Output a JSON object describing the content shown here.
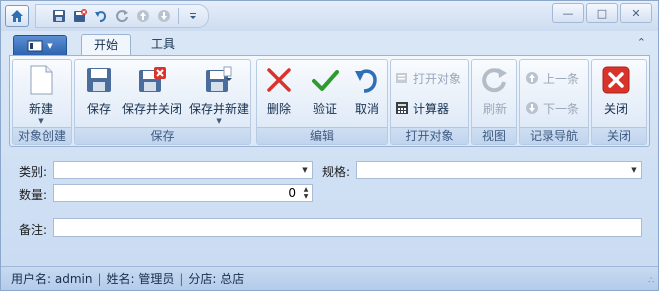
{
  "tabs": {
    "home": "开始",
    "tools": "工具"
  },
  "ribbon": {
    "groups": {
      "create": "对象创建",
      "save": "保存",
      "edit": "编辑",
      "open": "打开对象",
      "view": "视图",
      "nav": "记录导航",
      "close": "关闭"
    },
    "buttons": {
      "new": "新建",
      "save": "保存",
      "save_close": "保存并关闭",
      "save_new": "保存并新建",
      "delete": "删除",
      "validate": "验证",
      "cancel": "取消",
      "open_object": "打开对象",
      "calculator": "计算器",
      "refresh": "刷新",
      "prev": "上一条",
      "next": "下一条",
      "close": "关闭"
    }
  },
  "form": {
    "category_label": "类别:",
    "category_value": "",
    "spec_label": "规格:",
    "spec_value": "",
    "quantity_label": "数量:",
    "quantity_value": "0",
    "remark_label": "备注:",
    "remark_value": ""
  },
  "status": {
    "username": "用户名: admin",
    "name": "姓名: 管理员",
    "branch": "分店: 总店"
  },
  "colors": {
    "accent": "#2e63b0",
    "close_red": "#d9342b",
    "validate_green": "#2f9b2f"
  }
}
